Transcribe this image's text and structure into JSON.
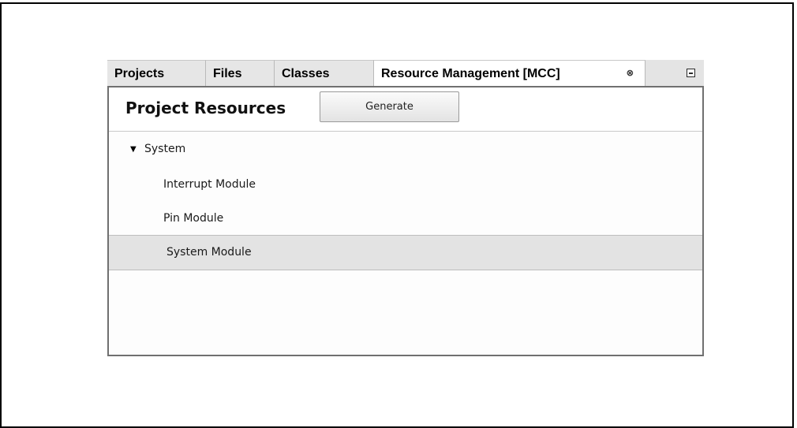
{
  "tabs": [
    {
      "label": "Projects",
      "active": false
    },
    {
      "label": "Files",
      "active": false
    },
    {
      "label": "Classes",
      "active": false
    },
    {
      "label": "Resource Management [MCC]",
      "active": true
    }
  ],
  "tab_close_glyph": "⊗",
  "panel": {
    "title": "Project Resources",
    "generate_label": "Generate"
  },
  "tree": {
    "root": {
      "label": "System",
      "expanded": true
    },
    "children": [
      {
        "label": "Interrupt Module",
        "selected": false
      },
      {
        "label": "Pin Module",
        "selected": false
      },
      {
        "label": "System Module",
        "selected": true
      }
    ]
  },
  "icons": {
    "expand_arrow": "triangle-down-icon",
    "tab_close": "close-icon",
    "minimize": "minimize-icon"
  }
}
